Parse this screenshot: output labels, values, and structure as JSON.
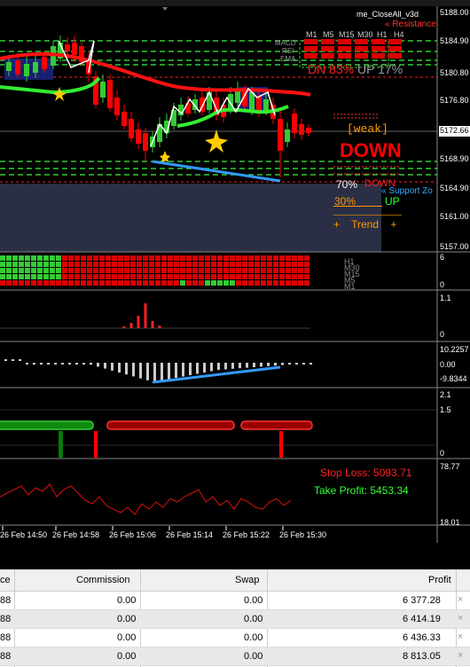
{
  "window": {
    "title": "me_CloseAll_v3d"
  },
  "price_scale": [
    "5188.00",
    "5184.90",
    "5180.80",
    "5176.80",
    "5172.66",
    "5168.90",
    "5164.90",
    "5161.00",
    "5157.00"
  ],
  "resistance_label": "« Resistance",
  "support_label": "« Support Zo",
  "timeframes": [
    "M1",
    "M5",
    "M15",
    "M30",
    "H1",
    "H4"
  ],
  "indicator_labels": [
    "MACD",
    "RSI",
    "EMA"
  ],
  "dn_up": {
    "dn": "DN 83%",
    "up": "UP 17%"
  },
  "weak_label": "[weak]",
  "signal": "DOWN",
  "down_pct": "70%",
  "down_label": "DOWN",
  "up_pct": "30%",
  "up_label": "UP",
  "trend_label": "+    Trend    +",
  "heatmap_scale": [
    "6",
    "0"
  ],
  "heatmap_labels": [
    "H1",
    "M30",
    "M15",
    "M5",
    "M1"
  ],
  "sub1_scale": [
    "1.1",
    "0"
  ],
  "sub2_scale": [
    "10.2257",
    "0.00",
    "-9.8344"
  ],
  "sub3_scale": [
    "2.1",
    "1.5",
    "0"
  ],
  "stop_loss": "Stop Loss: 5093.71",
  "take_profit": "Take Profit: 5453.34",
  "sub4_scale": [
    "78.77",
    "18.01"
  ],
  "time_labels": [
    "26 Feb 14:50",
    "26 Feb 14:58",
    "26 Feb 15:06",
    "26 Feb 15:14",
    "26 Feb 15:22",
    "26 Feb 15:30"
  ],
  "table": {
    "headers": [
      "ce",
      "Commission",
      "Swap",
      "Profit"
    ],
    "rows": [
      {
        "c0": "88",
        "commission": "0.00",
        "swap": "0.00",
        "profit": "6 377.28"
      },
      {
        "c0": "88",
        "commission": "0.00",
        "swap": "0.00",
        "profit": "6 414.19"
      },
      {
        "c0": "88",
        "commission": "0.00",
        "swap": "0.00",
        "profit": "6 436.33"
      },
      {
        "c0": "88",
        "commission": "0.00",
        "swap": "0.00",
        "profit": "8 813.05"
      }
    ],
    "close_glyph": "×"
  },
  "colors": {
    "up": "#33cc33",
    "down": "#ff0000",
    "background": "#000000",
    "zone": "#2a2f45"
  }
}
